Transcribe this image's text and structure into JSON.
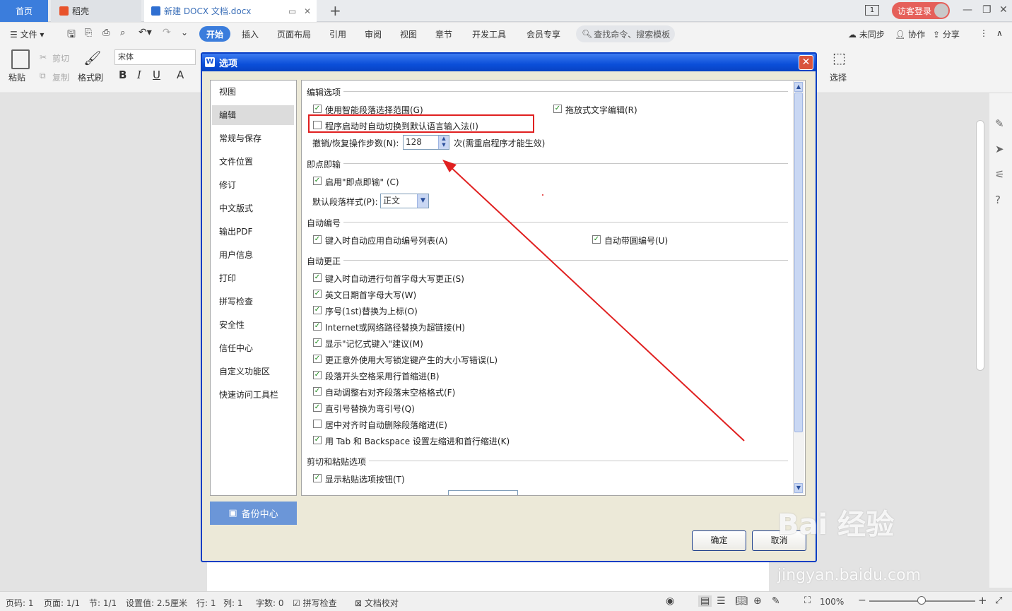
{
  "tabs": {
    "home": "首页",
    "daoke": "稻壳",
    "doc": "新建 DOCX 文档.docx",
    "new_tab": "+"
  },
  "titlebar": {
    "page_indicator": "1",
    "login": "访客登录"
  },
  "menu": {
    "file": "文件",
    "items": [
      "开始",
      "插入",
      "页面布局",
      "引用",
      "审阅",
      "视图",
      "章节",
      "开发工具",
      "会员专享"
    ],
    "search": "查找命令、搜索模板",
    "sync": "未同步",
    "collab": "协作",
    "share": "分享"
  },
  "ribbon": {
    "paste": "粘贴",
    "cut": "剪切",
    "copy": "复制",
    "format_painter": "格式刷",
    "font": "宋体",
    "select": "选择"
  },
  "dialog": {
    "title": "选项",
    "nav": [
      "视图",
      "编辑",
      "常规与保存",
      "文件位置",
      "修订",
      "中文版式",
      "输出PDF",
      "用户信息",
      "打印",
      "拼写检查",
      "安全性",
      "信任中心",
      "自定义功能区",
      "快速访问工具栏"
    ],
    "selected_nav": "编辑",
    "backup": "备份中心",
    "sections": {
      "edit": "编辑选项",
      "click_type": "即点即输",
      "auto_number": "自动编号",
      "auto_correct": "自动更正",
      "cut_paste": "剪切和粘贴选项"
    },
    "edit_options": [
      {
        "label": "使用智能段落选择范围(G)",
        "checked": true
      },
      {
        "label": "拖放式文字编辑(R)",
        "checked": true
      },
      {
        "label": "程序启动时自动切换到默认语言输入法(I)",
        "checked": false
      }
    ],
    "undo_label": "撤销/恢复操作步数(N):",
    "undo_value": "128",
    "undo_note": "次(需重启程序才能生效)",
    "click_type_enable": {
      "label": "启用\"即点即输\" (C)",
      "checked": true
    },
    "default_style_label": "默认段落样式(P):",
    "default_style_value": "正文",
    "auto_number_options": [
      {
        "label": "键入时自动应用自动编号列表(A)",
        "checked": true
      },
      {
        "label": "自动带圆编号(U)",
        "checked": true
      }
    ],
    "auto_correct_options": [
      {
        "label": "键入时自动进行句首字母大写更正(S)",
        "checked": true
      },
      {
        "label": "英文日期首字母大写(W)",
        "checked": true
      },
      {
        "label": "序号(1st)替换为上标(O)",
        "checked": true
      },
      {
        "label": "Internet或网络路径替换为超链接(H)",
        "checked": true
      },
      {
        "label": "显示\"记忆式键入\"建议(M)",
        "checked": true
      },
      {
        "label": "更正意外使用大写锁定键产生的大小写错误(L)",
        "checked": true
      },
      {
        "label": "段落开头空格采用行首缩进(B)",
        "checked": true
      },
      {
        "label": "自动调整右对齐段落末空格格式(F)",
        "checked": true
      },
      {
        "label": "直引号替换为弯引号(Q)",
        "checked": true
      },
      {
        "label": "居中对齐时自动删除段落缩进(E)",
        "checked": false
      },
      {
        "label": "用 Tab 和 Backspace 设置左缩进和首行缩进(K)",
        "checked": true
      }
    ],
    "cut_paste_options": [
      {
        "label": "显示粘贴选项按钮(T)",
        "checked": true
      }
    ],
    "ok": "确定",
    "cancel": "取消"
  },
  "status": {
    "page": "页码: 1",
    "pages": "页面: 1/1",
    "section": "节: 1/1",
    "setting": "设置值: 2.5厘米",
    "row": "行: 1",
    "col": "列: 1",
    "words": "字数: 0",
    "spell": "拼写检查",
    "proof": "文档校对",
    "zoom": "100%"
  },
  "watermark": {
    "brand": "Bai 经验",
    "url": "jingyan.baidu.com"
  },
  "colors": {
    "accent": "#3b7ddc",
    "dialog_border": "#0a3fc4",
    "highlight": "#e02020",
    "arrow": "#e02020"
  }
}
